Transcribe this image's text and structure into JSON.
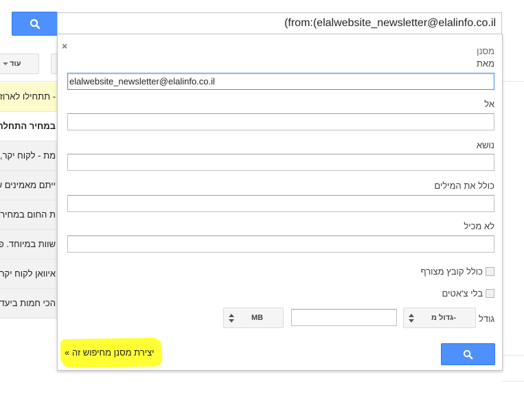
{
  "search": {
    "query": "(from:(elalwebsite_newsletter@elalinfo.co.il",
    "button_icon": "search-icon",
    "accent_color": "#4d90fe"
  },
  "toolbar": {
    "more_label": "עוד"
  },
  "background_rows": [
    {
      "text": "- תתחילו לארוז",
      "style": "yellow"
    },
    {
      "text": "במחיר התחלת",
      "style": "white"
    },
    {
      "text": "מת - לקוח יקר,",
      "style": "gray"
    },
    {
      "text": "ייתם מאמינים ש",
      "style": "gray"
    },
    {
      "text": "ת החום במחירים",
      "style": "gray"
    },
    {
      "text": "שוות במיוחד. פ",
      "style": "gray"
    },
    {
      "text": "איוואן לקוח יקר",
      "style": "gray"
    },
    {
      "text": "הכי חמות ביעד",
      "style": "gray"
    }
  ],
  "filter_panel": {
    "close": "×",
    "title": "מסנן",
    "from_label": "מאת",
    "from_value": "elalwebsite_newsletter@elalinfo.co.il",
    "to_label": "אל",
    "to_value": "",
    "subject_label": "נושא",
    "subject_value": "",
    "has_words_label": "כולל את המילים",
    "has_words_value": "",
    "doesnt_have_label": "לא מכיל",
    "doesnt_have_value": "",
    "has_attachment_label": "כולל קובץ מצורף",
    "has_attachment_checked": false,
    "no_chats_label": "בלי צ'אטים",
    "no_chats_checked": false,
    "size_label": "גודל",
    "size_operator": "גדול מ-",
    "size_value": "",
    "size_unit": "MB",
    "create_filter_link": "יצירת מסנן מחיפוש זה »",
    "search_button_icon": "search-icon"
  }
}
